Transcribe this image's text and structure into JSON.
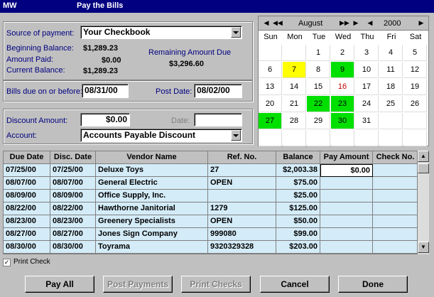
{
  "window": {
    "app_label": "MW",
    "title": "Pay the Bills"
  },
  "payment": {
    "source_label": "Source of payment:",
    "source_value": "Your Checkbook",
    "beginning_label": "Beginning Balance:",
    "beginning_value": "$1,289.23",
    "paid_label": "Amount Paid:",
    "paid_value": "$0.00",
    "current_label": "Current Balance:",
    "current_value": "$1,289.23",
    "remaining_label": "Remaining Amount Due",
    "remaining_value": "$3,296.60"
  },
  "dates": {
    "due_label": "Bills due on or before:",
    "due_value": "08/31/00",
    "post_label": "Post Date:",
    "post_value": "08/02/00"
  },
  "discount": {
    "amount_label": "Discount Amount:",
    "amount_value": "$0.00",
    "date_label": "Date:",
    "date_value": "",
    "account_label": "Account:",
    "account_value": "Accounts Payable Discount"
  },
  "calendar": {
    "month": "August",
    "year": "2000",
    "weekdays": [
      "Sun",
      "Mon",
      "Tue",
      "Wed",
      "Thu",
      "Fri",
      "Sat"
    ],
    "colors": {
      "yellow": "#ffff00",
      "green": "#00e000",
      "red": "#c00000"
    },
    "days": [
      {
        "d": "",
        "c": ""
      },
      {
        "d": "",
        "c": ""
      },
      {
        "d": "1",
        "c": ""
      },
      {
        "d": "2",
        "c": ""
      },
      {
        "d": "3",
        "c": ""
      },
      {
        "d": "4",
        "c": ""
      },
      {
        "d": "5",
        "c": ""
      },
      {
        "d": "6",
        "c": ""
      },
      {
        "d": "7",
        "c": "yellow"
      },
      {
        "d": "8",
        "c": ""
      },
      {
        "d": "9",
        "c": "green"
      },
      {
        "d": "10",
        "c": ""
      },
      {
        "d": "11",
        "c": ""
      },
      {
        "d": "12",
        "c": ""
      },
      {
        "d": "13",
        "c": ""
      },
      {
        "d": "14",
        "c": ""
      },
      {
        "d": "15",
        "c": ""
      },
      {
        "d": "16",
        "c": "red"
      },
      {
        "d": "17",
        "c": ""
      },
      {
        "d": "18",
        "c": ""
      },
      {
        "d": "19",
        "c": ""
      },
      {
        "d": "20",
        "c": ""
      },
      {
        "d": "21",
        "c": ""
      },
      {
        "d": "22",
        "c": "green"
      },
      {
        "d": "23",
        "c": "green"
      },
      {
        "d": "24",
        "c": ""
      },
      {
        "d": "25",
        "c": ""
      },
      {
        "d": "26",
        "c": ""
      },
      {
        "d": "27",
        "c": "green"
      },
      {
        "d": "28",
        "c": ""
      },
      {
        "d": "29",
        "c": ""
      },
      {
        "d": "30",
        "c": "green"
      },
      {
        "d": "31",
        "c": ""
      },
      {
        "d": "",
        "c": ""
      },
      {
        "d": "",
        "c": ""
      },
      {
        "d": "",
        "c": ""
      },
      {
        "d": "",
        "c": ""
      },
      {
        "d": "",
        "c": ""
      },
      {
        "d": "",
        "c": ""
      },
      {
        "d": "",
        "c": ""
      },
      {
        "d": "",
        "c": ""
      },
      {
        "d": "",
        "c": ""
      }
    ]
  },
  "table": {
    "headers": [
      "Due Date",
      "Disc. Date",
      "Vendor Name",
      "Ref. No.",
      "Balance",
      "Pay Amount",
      "Check No."
    ],
    "rows": [
      [
        "07/25/00",
        "07/25/00",
        "Deluxe Toys",
        "27",
        "$2,003.38",
        "$0.00",
        ""
      ],
      [
        "08/07/00",
        "08/07/00",
        "General Electric",
        "OPEN",
        "$75.00",
        "",
        ""
      ],
      [
        "08/09/00",
        "08/09/00",
        "Office Supply, Inc.",
        "",
        "$25.00",
        "",
        ""
      ],
      [
        "08/22/00",
        "08/22/00",
        "Hawthorne Janitorial",
        "1279",
        "$125.00",
        "",
        ""
      ],
      [
        "08/23/00",
        "08/23/00",
        "Greenery Specialists",
        "OPEN",
        "$50.00",
        "",
        ""
      ],
      [
        "08/27/00",
        "08/27/00",
        "Jones Sign Company",
        "999080",
        "$99.00",
        "",
        ""
      ],
      [
        "08/30/00",
        "08/30/00",
        "Toyrama",
        "9320329328",
        "$203.00",
        "",
        ""
      ]
    ]
  },
  "print_check": {
    "label": "Print Check",
    "checked": true
  },
  "buttons": {
    "pay_all": "Pay All",
    "post_payments": "Post Payments",
    "print_checks": "Print Checks",
    "cancel": "Cancel",
    "done": "Done"
  }
}
